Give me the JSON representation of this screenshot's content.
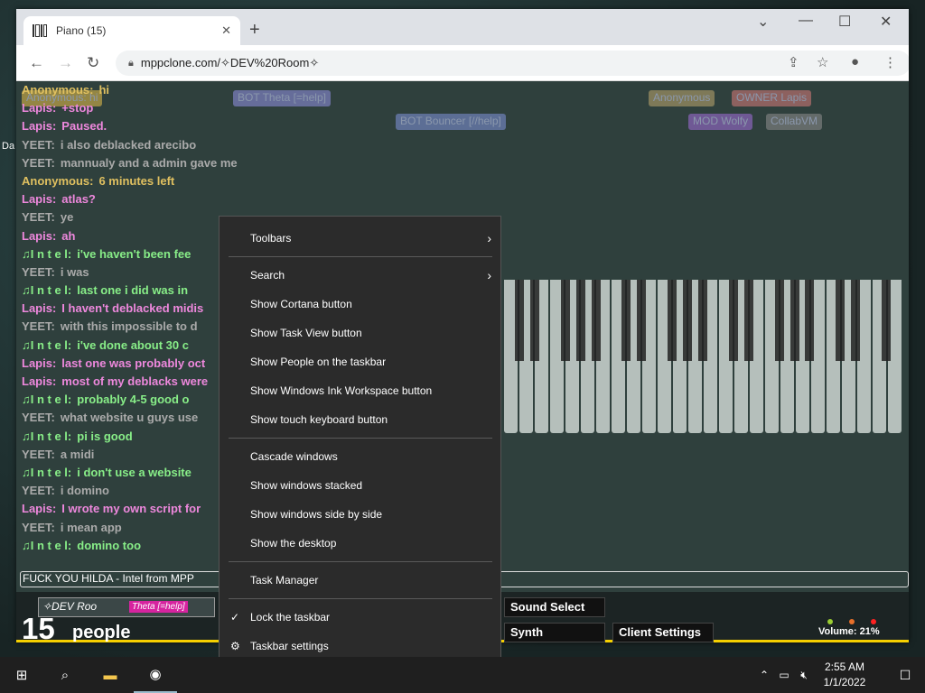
{
  "desktop": {
    "icon_label": "Da"
  },
  "browser": {
    "tab_title": "Piano (15)",
    "tab_close": "✕",
    "newtab": "+",
    "url": "mppclone.com/✧DEV%20Room✧",
    "win_min": "—",
    "win_max": "☐",
    "win_close": "✕"
  },
  "userbar": [
    {
      "label": "Anonymous: hi",
      "color": "#d8b64a"
    },
    {
      "label": "BOT Theta [=help]",
      "color": "#8b8bd9"
    },
    {
      "label": "Anonymous",
      "color": "#b3a06a"
    },
    {
      "label": "OWNER Lapis",
      "color": "#c77"
    },
    {
      "label": "BOT Bouncer [//help]",
      "color": "#7b8ed0"
    },
    {
      "label": "MOD Wolfy",
      "color": "#9b6bd0"
    },
    {
      "label": "CollabVM",
      "color": "#888"
    }
  ],
  "chat": [
    {
      "nick": "Anonymous:",
      "text": "hi",
      "color": "#e0c060"
    },
    {
      "nick": "Lapis:",
      "text": "+stop",
      "color": "#ee88dd"
    },
    {
      "nick": "Lapis:",
      "text": "Paused.",
      "color": "#ee88dd"
    },
    {
      "nick": "YEET:",
      "text": "i also deblacked arecibo",
      "color": "#aaaaaa"
    },
    {
      "nick": "YEET:",
      "text": "mannualy and a admin gave me",
      "color": "#aaaaaa"
    },
    {
      "nick": "Anonymous:",
      "text": "6 minutes left",
      "color": "#e0c060"
    },
    {
      "nick": "Lapis:",
      "text": "atlas?",
      "color": "#ee88dd"
    },
    {
      "nick": "YEET:",
      "text": "ye",
      "color": "#aaaaaa"
    },
    {
      "nick": "Lapis:",
      "text": "ah",
      "color": "#ee88dd"
    },
    {
      "nick": "♫I n t e l:",
      "text": "i've haven't been fee",
      "color": "#88ee88"
    },
    {
      "nick": "YEET:",
      "text": "i was",
      "color": "#aaaaaa"
    },
    {
      "nick": "♫I n t e l:",
      "text": "last one i did was in",
      "color": "#88ee88"
    },
    {
      "nick": "Lapis:",
      "text": "I haven't deblacked midis",
      "color": "#ee88dd"
    },
    {
      "nick": "YEET:",
      "text": "with this impossible to d",
      "color": "#aaaaaa"
    },
    {
      "nick": "♫I n t e l:",
      "text": "i've done about 30 c",
      "color": "#88ee88"
    },
    {
      "nick": "Lapis:",
      "text": "last one was probably oct",
      "color": "#ee88dd"
    },
    {
      "nick": "Lapis:",
      "text": "most of my deblacks were",
      "color": "#ee88dd"
    },
    {
      "nick": "♫I n t e l:",
      "text": "probably 4-5 good o",
      "color": "#88ee88"
    },
    {
      "nick": "YEET:",
      "text": "what website u guys use",
      "color": "#aaaaaa"
    },
    {
      "nick": "♫I n t e l:",
      "text": "pi is good",
      "color": "#88ee88"
    },
    {
      "nick": "YEET:",
      "text": "a midi",
      "color": "#aaaaaa"
    },
    {
      "nick": "♫I n t e l:",
      "text": "i don't use a website",
      "color": "#88ee88"
    },
    {
      "nick": "YEET:",
      "text": "i domino",
      "color": "#aaaaaa"
    },
    {
      "nick": "Lapis:",
      "text": "I wrote my own script for",
      "color": "#ee88dd"
    },
    {
      "nick": "YEET:",
      "text": "i mean app",
      "color": "#aaaaaa"
    },
    {
      "nick": "♫I n t e l:",
      "text": "domino too",
      "color": "#88ee88"
    }
  ],
  "chat_input_value": "FUCK YOU HILDA - Intel from MPP",
  "room": {
    "name": "✧DEV Roo",
    "tag": "Theta [=help]"
  },
  "people": {
    "count": "15",
    "label": "people"
  },
  "controls": {
    "sound_select": "Sound Select",
    "synth": "Synth",
    "client_settings": "Client Settings",
    "volume": "Volume: 21%"
  },
  "context_menu": [
    {
      "label": "Toolbars",
      "submenu": true
    },
    {
      "label": "Search",
      "submenu": true
    },
    {
      "label": "Show Cortana button"
    },
    {
      "label": "Show Task View button"
    },
    {
      "label": "Show People on the taskbar"
    },
    {
      "label": "Show Windows Ink Workspace button"
    },
    {
      "label": "Show touch keyboard button"
    },
    {
      "label": "Cascade windows"
    },
    {
      "label": "Show windows stacked"
    },
    {
      "label": "Show windows side by side"
    },
    {
      "label": "Show the desktop"
    },
    {
      "label": "Task Manager"
    },
    {
      "label": "Lock the taskbar",
      "checked": true
    },
    {
      "label": "Taskbar settings",
      "gear": true
    }
  ],
  "taskbar": {
    "time": "2:55 AM",
    "date": "1/1/2022"
  }
}
